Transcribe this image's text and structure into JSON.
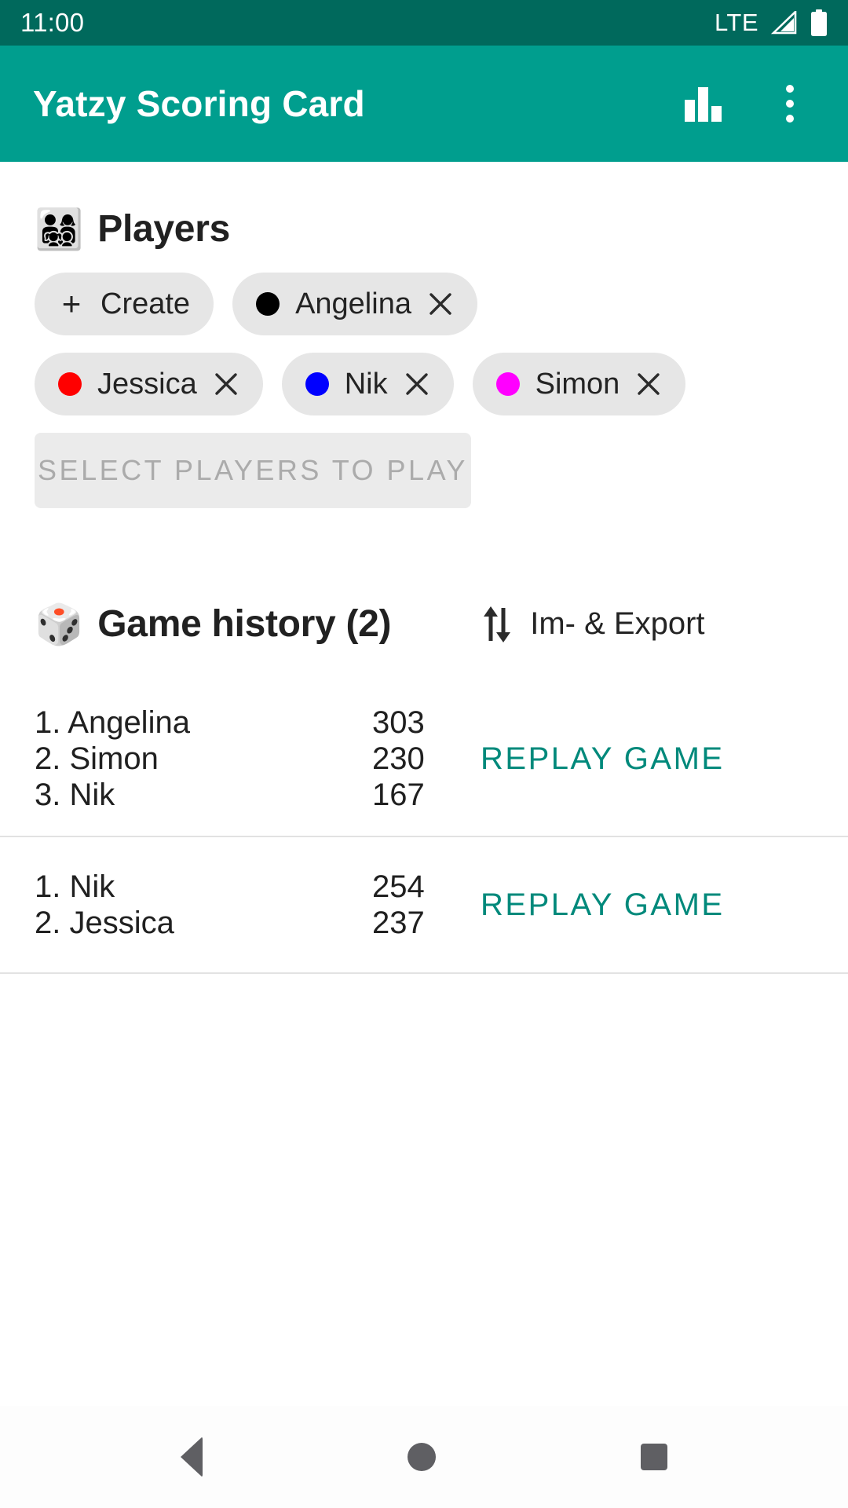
{
  "status_bar": {
    "clock": "11:00",
    "network": "LTE",
    "signal_icon": "signal-triangle-icon",
    "battery_icon": "battery-full-icon"
  },
  "app_bar": {
    "title": "Yatzy Scoring Card",
    "stats_icon": "bar-chart-icon",
    "overflow_icon": "overflow-menu-icon",
    "background_color": "#009E8E"
  },
  "players": {
    "emoji": "👨‍👩‍👧‍👦",
    "title": "Players",
    "create_label": "Create",
    "create_icon": "plus-icon",
    "chips": [
      {
        "name": "Angelina",
        "color": "#000000",
        "remove_icon": "close-icon"
      },
      {
        "name": "Jessica",
        "color": "#FF0000",
        "remove_icon": "close-icon"
      },
      {
        "name": "Nik",
        "color": "#0000FF",
        "remove_icon": "close-icon"
      },
      {
        "name": "Simon",
        "color": "#FF00FF",
        "remove_icon": "close-icon"
      }
    ],
    "select_button_label": "SELECT PLAYERS TO PLAY",
    "select_button_enabled": false
  },
  "game_history": {
    "emoji": "🎲",
    "title": "Game history (2)",
    "export_label": "Im- & Export",
    "export_icon": "swap-vertical-icon",
    "replay_label": "REPLAY GAME",
    "replay_color": "#00897B",
    "entries": [
      {
        "ranks": [
          {
            "position": "1. Angelina",
            "score": "303"
          },
          {
            "position": "2. Simon",
            "score": "230"
          },
          {
            "position": "3. Nik",
            "score": "167"
          }
        ]
      },
      {
        "ranks": [
          {
            "position": "1. Nik",
            "score": "254"
          },
          {
            "position": "2. Jessica",
            "score": "237"
          }
        ]
      }
    ]
  },
  "nav_bar": {
    "back_icon": "back-triangle-icon",
    "home_icon": "home-circle-icon",
    "recents_icon": "recents-square-icon"
  }
}
